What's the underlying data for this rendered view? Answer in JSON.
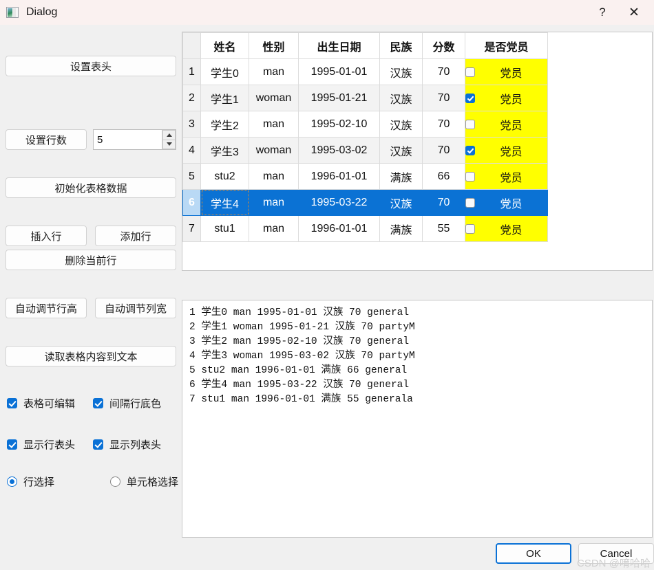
{
  "window": {
    "title": "Dialog",
    "help_label": "?",
    "close_label": "✕"
  },
  "sidebar": {
    "buttons": [
      {
        "label": "设置表头"
      },
      {
        "label": "设置行数"
      },
      {
        "label": "初始化表格数据"
      },
      {
        "label": "插入行"
      },
      {
        "label": "添加行"
      },
      {
        "label": "删除当前行"
      },
      {
        "label": "自动调节行高"
      },
      {
        "label": "自动调节列宽"
      },
      {
        "label": "读取表格内容到文本"
      }
    ],
    "row_count_spin": {
      "value": "5"
    },
    "checkboxes": [
      {
        "label": "表格可编辑",
        "checked": true
      },
      {
        "label": "间隔行底色",
        "checked": true
      },
      {
        "label": "显示行表头",
        "checked": true
      },
      {
        "label": "显示列表头",
        "checked": true
      }
    ],
    "radios": [
      {
        "label": "行选择",
        "selected": true
      },
      {
        "label": "单元格选择",
        "selected": false
      }
    ]
  },
  "table": {
    "headers": [
      "姓名",
      "性别",
      "出生日期",
      "民族",
      "分数",
      "是否党员"
    ],
    "header_color": "#ff0000",
    "party_cell_bg": "#ffff00",
    "selection_color": "#0b72d4",
    "rows": [
      {
        "num": "1",
        "name": "学生0",
        "sex": "man",
        "birth": "1995-01-01",
        "ethnic": "汉族",
        "score": "70",
        "party_checked": false,
        "party_label": "党员",
        "selected": false
      },
      {
        "num": "2",
        "name": "学生1",
        "sex": "woman",
        "birth": "1995-01-21",
        "ethnic": "汉族",
        "score": "70",
        "party_checked": true,
        "party_label": "党员",
        "selected": false
      },
      {
        "num": "3",
        "name": "学生2",
        "sex": "man",
        "birth": "1995-02-10",
        "ethnic": "汉族",
        "score": "70",
        "party_checked": false,
        "party_label": "党员",
        "selected": false
      },
      {
        "num": "4",
        "name": "学生3",
        "sex": "woman",
        "birth": "1995-03-02",
        "ethnic": "汉族",
        "score": "70",
        "party_checked": true,
        "party_label": "党员",
        "selected": false
      },
      {
        "num": "5",
        "name": "stu2",
        "sex": "man",
        "birth": "1996-01-01",
        "ethnic": "满族",
        "score": "66",
        "party_checked": false,
        "party_label": "党员",
        "selected": false
      },
      {
        "num": "6",
        "name": "学生4",
        "sex": "man",
        "birth": "1995-03-22",
        "ethnic": "汉族",
        "score": "70",
        "party_checked": false,
        "party_label": "党员",
        "selected": true
      },
      {
        "num": "7",
        "name": "stu1",
        "sex": "man",
        "birth": "1996-01-01",
        "ethnic": "满族",
        "score": "55",
        "party_checked": false,
        "party_label": "党员",
        "selected": false
      }
    ]
  },
  "text_output": {
    "content": "1 学生0 man 1995-01-01 汉族 70 general\n2 学生1 woman 1995-01-21 汉族 70 partyM\n3 学生2 man 1995-02-10 汉族 70 general\n4 学生3 woman 1995-03-02 汉族 70 partyM\n5 stu2 man 1996-01-01 满族 66 general\n6 学生4 man 1995-03-22 汉族 70 general\n7 stu1 man 1996-01-01 满族 55 generala"
  },
  "footer": {
    "ok_label": "OK",
    "cancel_label": "Cancel",
    "watermark": "CSDN @唷哈哈"
  }
}
